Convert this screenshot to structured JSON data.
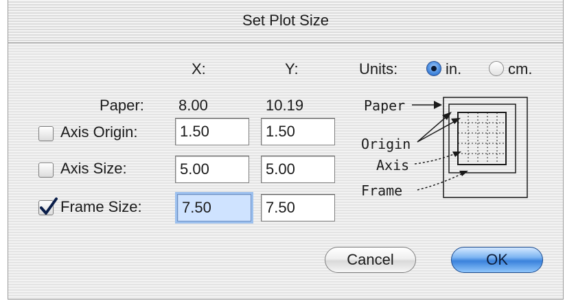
{
  "dialog": {
    "title": "Set Plot Size"
  },
  "headers": {
    "x": "X:",
    "y": "Y:"
  },
  "units": {
    "label": "Units:",
    "options": [
      "in.",
      "cm."
    ],
    "selected": "in."
  },
  "paper": {
    "label": "Paper:",
    "x": "8.00",
    "y": "10.19"
  },
  "rows": [
    {
      "label": "Axis Origin:",
      "checked": false,
      "x": "1.50",
      "y": "1.50"
    },
    {
      "label": "Axis Size:",
      "checked": false,
      "x": "5.00",
      "y": "5.00"
    },
    {
      "label": "Frame Size:",
      "checked": true,
      "x": "7.50",
      "y": "7.50",
      "focused": "x"
    }
  ],
  "diagram": {
    "labels": [
      "Paper",
      "Origin",
      "Axis",
      "Frame"
    ]
  },
  "buttons": {
    "cancel": "Cancel",
    "ok": "OK",
    "default": "ok"
  },
  "colors": {
    "accent": "#3a82dc",
    "focus_ring": "#9cc0ee"
  }
}
